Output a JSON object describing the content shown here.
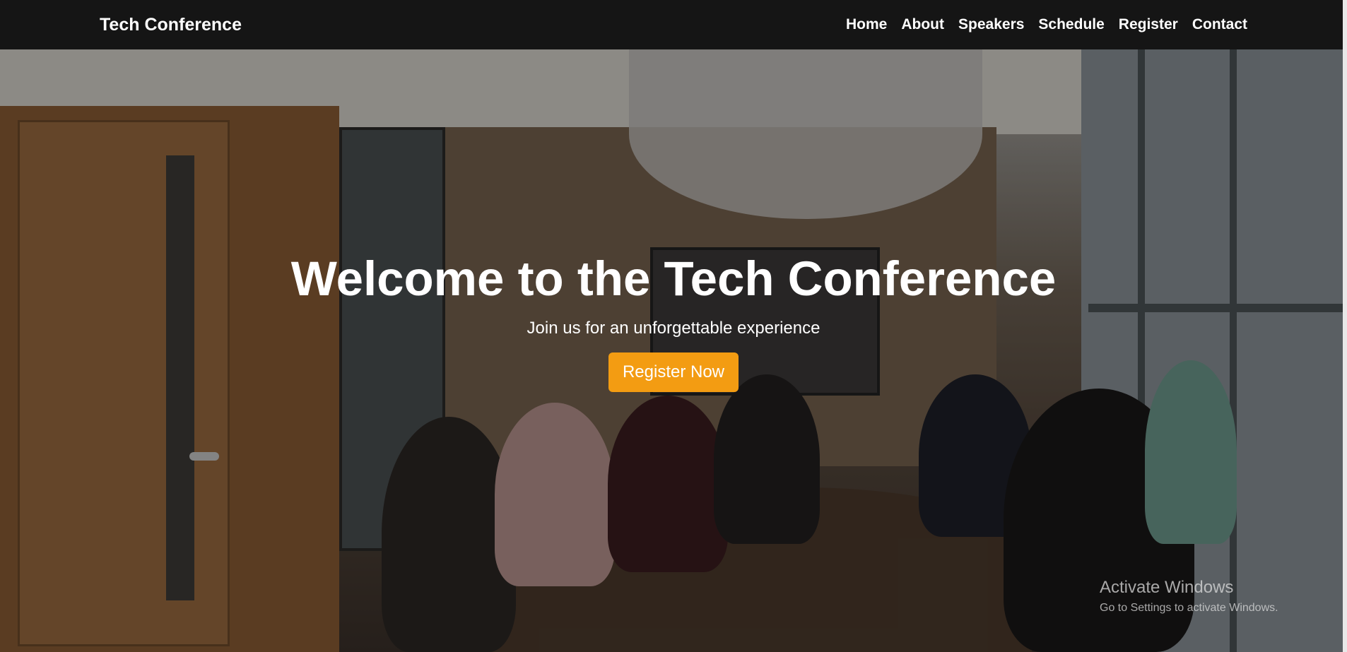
{
  "navbar": {
    "brand": "Tech Conference",
    "links": [
      "Home",
      "About",
      "Speakers",
      "Schedule",
      "Register",
      "Contact"
    ]
  },
  "hero": {
    "title": "Welcome to the Tech Conference",
    "subtitle": "Join us for an unforgettable experience",
    "cta_label": "Register Now",
    "accent_color": "#f39c12"
  },
  "watermark": {
    "title": "Activate Windows",
    "subtitle": "Go to Settings to activate Windows."
  }
}
